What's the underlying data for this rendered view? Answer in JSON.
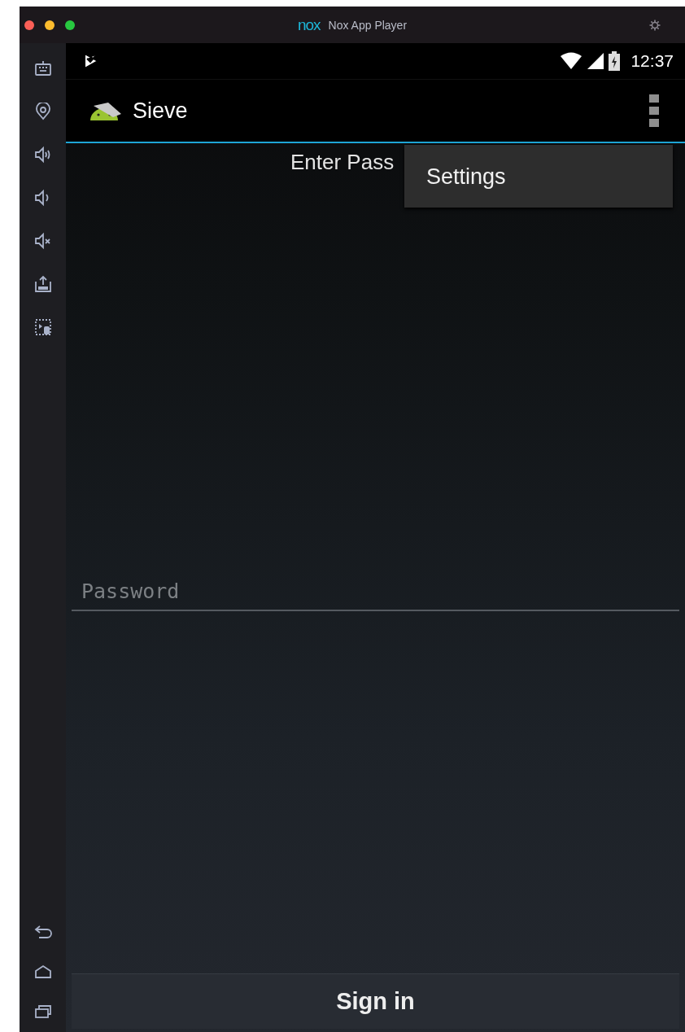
{
  "window": {
    "logo": "nox",
    "title": "Nox App Player"
  },
  "status_bar": {
    "time": "12:37"
  },
  "action_bar": {
    "title": "Sieve"
  },
  "heading": "Enter Pass",
  "menu": {
    "items": [
      {
        "label": "Settings"
      }
    ]
  },
  "password_field": {
    "placeholder": "Password"
  },
  "sign_in_button": {
    "label": "Sign in"
  }
}
